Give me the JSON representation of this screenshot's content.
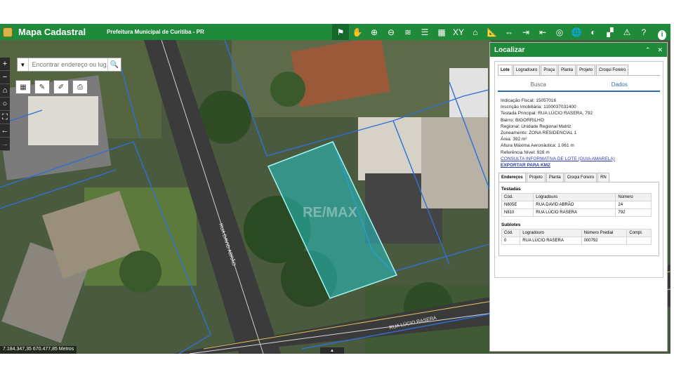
{
  "header": {
    "app_title": "Mapa Cadastral",
    "organization": "Prefeitura Municipal de Curitiba - PR",
    "tools": [
      {
        "name": "identify-tool-icon",
        "glyph": "⚑",
        "active": true
      },
      {
        "name": "pan-hand-icon",
        "glyph": "✋"
      },
      {
        "name": "zoom-in-icon",
        "glyph": "⊕"
      },
      {
        "name": "zoom-out-icon",
        "glyph": "⊖"
      },
      {
        "name": "layers-icon",
        "glyph": "≋"
      },
      {
        "name": "list-icon",
        "glyph": "☰"
      },
      {
        "name": "grid-icon",
        "glyph": "▦"
      },
      {
        "name": "xy-coordinates-icon",
        "glyph": "XY"
      },
      {
        "name": "hat-icon",
        "glyph": "⌂"
      },
      {
        "name": "ruler-icon",
        "glyph": "📐"
      },
      {
        "name": "expand-icon",
        "glyph": "⇔"
      },
      {
        "name": "import-icon",
        "glyph": "⇥"
      },
      {
        "name": "export-icon",
        "glyph": "⇤"
      },
      {
        "name": "target-icon",
        "glyph": "◎"
      },
      {
        "name": "globe-icon",
        "glyph": "🌐"
      },
      {
        "name": "basemap-icon",
        "glyph": "◐"
      },
      {
        "name": "blocks-icon",
        "glyph": "▞"
      },
      {
        "name": "warning-icon",
        "glyph": "⚠"
      },
      {
        "name": "help-icon",
        "glyph": "?"
      },
      {
        "name": "info-icon",
        "glyph": "i"
      }
    ]
  },
  "map": {
    "search_placeholder": "Encontrar endereço ou lug...",
    "coordinates": "7.184.347,35 670.477,85 Metros",
    "street_labels": [
      "RUA DAVID ABRÃO",
      "RUA LÚCIO RASERA"
    ],
    "watermark": "RE/MAX",
    "colors": {
      "parcel_outline": "#2f6fd6",
      "selected_fill": "#27c3c3"
    }
  },
  "panel": {
    "title": "Localizar",
    "tabs": [
      "Lote",
      "Logradouro",
      "Praça",
      "Planta",
      "Projeto",
      "Croqui Foreiro"
    ],
    "active_tab": "Lote",
    "segments": [
      "Busca",
      "Dados"
    ],
    "active_segment": "Dados",
    "fields": [
      {
        "label": "Indicação Fiscal:",
        "value": "15057016"
      },
      {
        "label": "Inscrição Imobiliária:",
        "value": "1100037031400"
      },
      {
        "label": "Testada Principal:",
        "value": "RUA LÚCIO RASERA, 792"
      },
      {
        "label": "Bairro:",
        "value": "BIGORRILHO"
      },
      {
        "label": "Regional:",
        "value": "Unidade Regional Matriz"
      },
      {
        "label": "Zoneamento:",
        "value": "ZONA RESIDENCIAL 1"
      },
      {
        "label": "Área:",
        "value": "392 m²"
      },
      {
        "label": "Altura Máxima Aeronáutica:",
        "value": "1.061 m"
      },
      {
        "label": "Referência Nível:",
        "value": "928 m"
      }
    ],
    "link_consulta": "CONSULTA INFORMATIVA DE LOTE (GUIA AMARELA)",
    "link_export": "EXPORTAR PARA KMZ",
    "subtabs": [
      "Endereços",
      "Projeto",
      "Planta",
      "Croqui Foreiro",
      "RN"
    ],
    "active_subtab": "Endereços",
    "testadas_title": "Testadas",
    "testadas_headers": [
      "Cód.",
      "Logradouro",
      "Número"
    ],
    "testadas_rows": [
      [
        "N805E",
        "RUA DAVID ABRÃO",
        "24"
      ],
      [
        "N810",
        "RUA LÚCIO RASERA",
        "792"
      ]
    ],
    "sublotes_title": "Sublotes",
    "sublotes_headers": [
      "Cód.",
      "Logradouro",
      "Número Predial",
      "Compl."
    ],
    "sublotes_rows": [
      [
        "0",
        "RUA LÚCIO RASERA",
        "000792",
        ""
      ]
    ]
  }
}
